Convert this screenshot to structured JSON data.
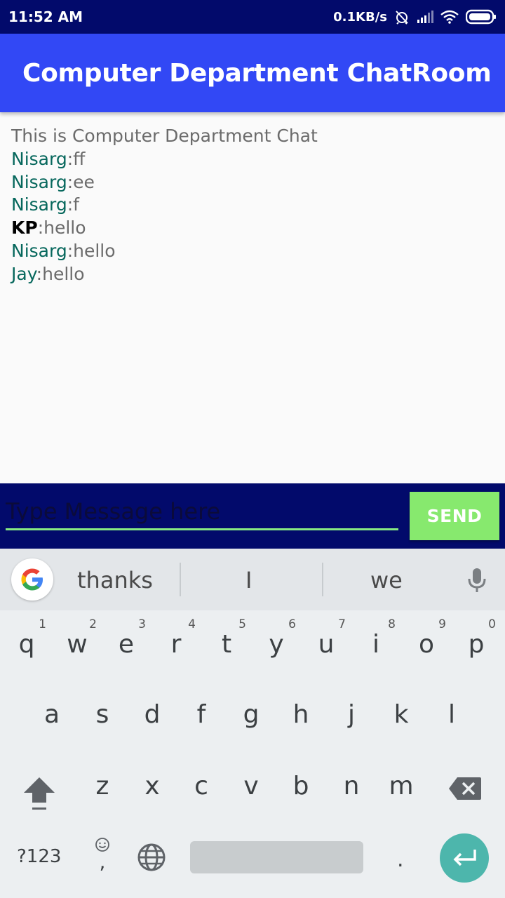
{
  "status_bar": {
    "time": "11:52 AM",
    "speed": "0.1KB/s",
    "icons": [
      "alarm-off-icon",
      "signal-icon",
      "wifi-icon",
      "battery-icon"
    ]
  },
  "app_bar": {
    "title": "Computer Department ChatRoom"
  },
  "chat": {
    "intro": "This is Computer Department Chat",
    "messages": [
      {
        "sender": "Nisarg",
        "text": ":ff"
      },
      {
        "sender": "Nisarg",
        "text": ":ee"
      },
      {
        "sender": "Nisarg",
        "text": ":f"
      },
      {
        "sender": "KP",
        "text": ":hello"
      },
      {
        "sender": "Nisarg",
        "text": ":hello"
      },
      {
        "sender": "Jay",
        "text": ":hello"
      }
    ]
  },
  "composer": {
    "placeholder": "Type Message here",
    "value": "",
    "send_label": "SEND"
  },
  "keyboard": {
    "suggestions": [
      "thanks",
      "I",
      "we"
    ],
    "row1": [
      {
        "key": "q",
        "hint": "1"
      },
      {
        "key": "w",
        "hint": "2"
      },
      {
        "key": "e",
        "hint": "3"
      },
      {
        "key": "r",
        "hint": "4"
      },
      {
        "key": "t",
        "hint": "5"
      },
      {
        "key": "y",
        "hint": "6"
      },
      {
        "key": "u",
        "hint": "7"
      },
      {
        "key": "i",
        "hint": "8"
      },
      {
        "key": "o",
        "hint": "9"
      },
      {
        "key": "p",
        "hint": "0"
      }
    ],
    "row2": [
      "a",
      "s",
      "d",
      "f",
      "g",
      "h",
      "j",
      "k",
      "l"
    ],
    "row3": [
      "z",
      "x",
      "c",
      "v",
      "b",
      "n",
      "m"
    ],
    "symbols_label": "?123",
    "comma": ",",
    "period": "."
  },
  "colors": {
    "status_bar": "#020a6b",
    "app_bar": "#3248f5",
    "sender": "#06675c",
    "send_button": "#87e96e",
    "enter_key": "#4db6ac"
  }
}
